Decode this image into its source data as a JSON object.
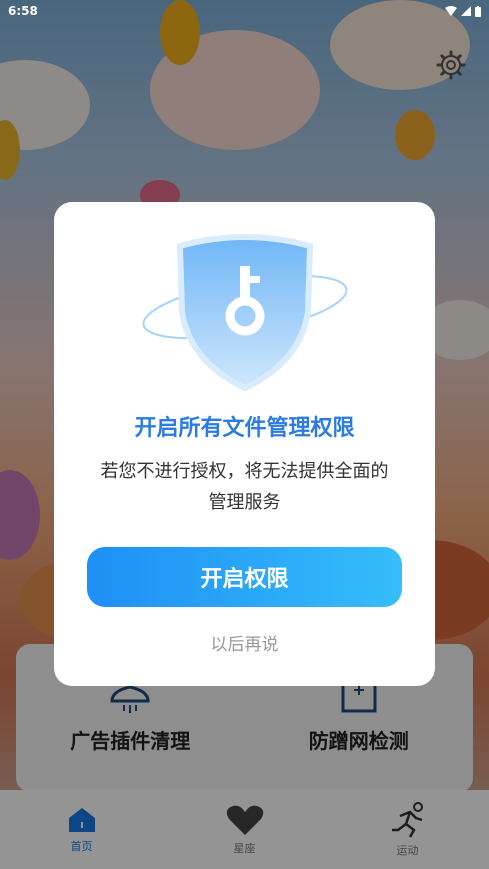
{
  "status_bar": {
    "time": "6:58"
  },
  "feature_cards": [
    {
      "label": "广告插件清理",
      "icon": "rocket-icon"
    },
    {
      "label": "防蹭网检测",
      "icon": "shield-check-icon"
    }
  ],
  "tabs": [
    {
      "label": "首页",
      "icon": "home-icon",
      "active": true
    },
    {
      "label": "星座",
      "icon": "heart-icon",
      "active": false
    },
    {
      "label": "运动",
      "icon": "running-icon",
      "active": false
    }
  ],
  "dialog": {
    "title": "开启所有文件管理权限",
    "message": "若您不进行授权，将无法提供全面的管理服务",
    "primary_button": "开启权限",
    "secondary_link": "以后再说"
  },
  "colors": {
    "accent": "#2b7be0",
    "button_start": "#1e8ff5",
    "button_end": "#36bdfa"
  }
}
